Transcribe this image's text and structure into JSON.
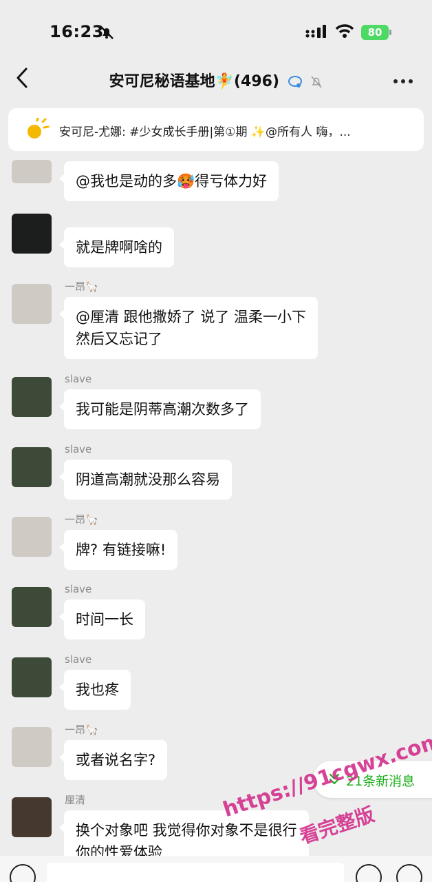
{
  "status_bar": {
    "time": "16:23",
    "battery": "80"
  },
  "header": {
    "title": "安可尼秘语基地🧚(496)"
  },
  "announcement": {
    "text": "安可尼-尤娜: #少女成长手册|第①期 ✨@所有人 嗨，..."
  },
  "messages": [
    {
      "sender": "",
      "text": "@我也是动的多🥵得亏体力好"
    },
    {
      "sender": "",
      "text": "就是牌啊啥的"
    },
    {
      "sender": "一昂🦙",
      "text": "@厘清 跟他撒娇了 说了 温柔一小下\n然后又忘记了"
    },
    {
      "sender": "slave",
      "text": "我可能是阴蒂高潮次数多了"
    },
    {
      "sender": "slave",
      "text": "阴道高潮就没那么容易"
    },
    {
      "sender": "一昂🦙",
      "text": "牌? 有链接嘛!"
    },
    {
      "sender": "slave",
      "text": "时间一长"
    },
    {
      "sender": "slave",
      "text": "我也疼"
    },
    {
      "sender": "一昂🦙",
      "text": "或者说名字?"
    },
    {
      "sender": "厘清",
      "text": "换个对象吧 我觉得你对象不是很行\n你的性爱体验"
    }
  ],
  "new_messages": {
    "label": "21条新消息"
  },
  "watermark": {
    "url": "https://91cgwx.com",
    "subtitle": "看完整版"
  },
  "colors": {
    "background": "#ededed",
    "bubble": "#ffffff",
    "accent_green": "#1aad19",
    "battery_green": "#4cd964",
    "watermark": "#d32f8c"
  }
}
